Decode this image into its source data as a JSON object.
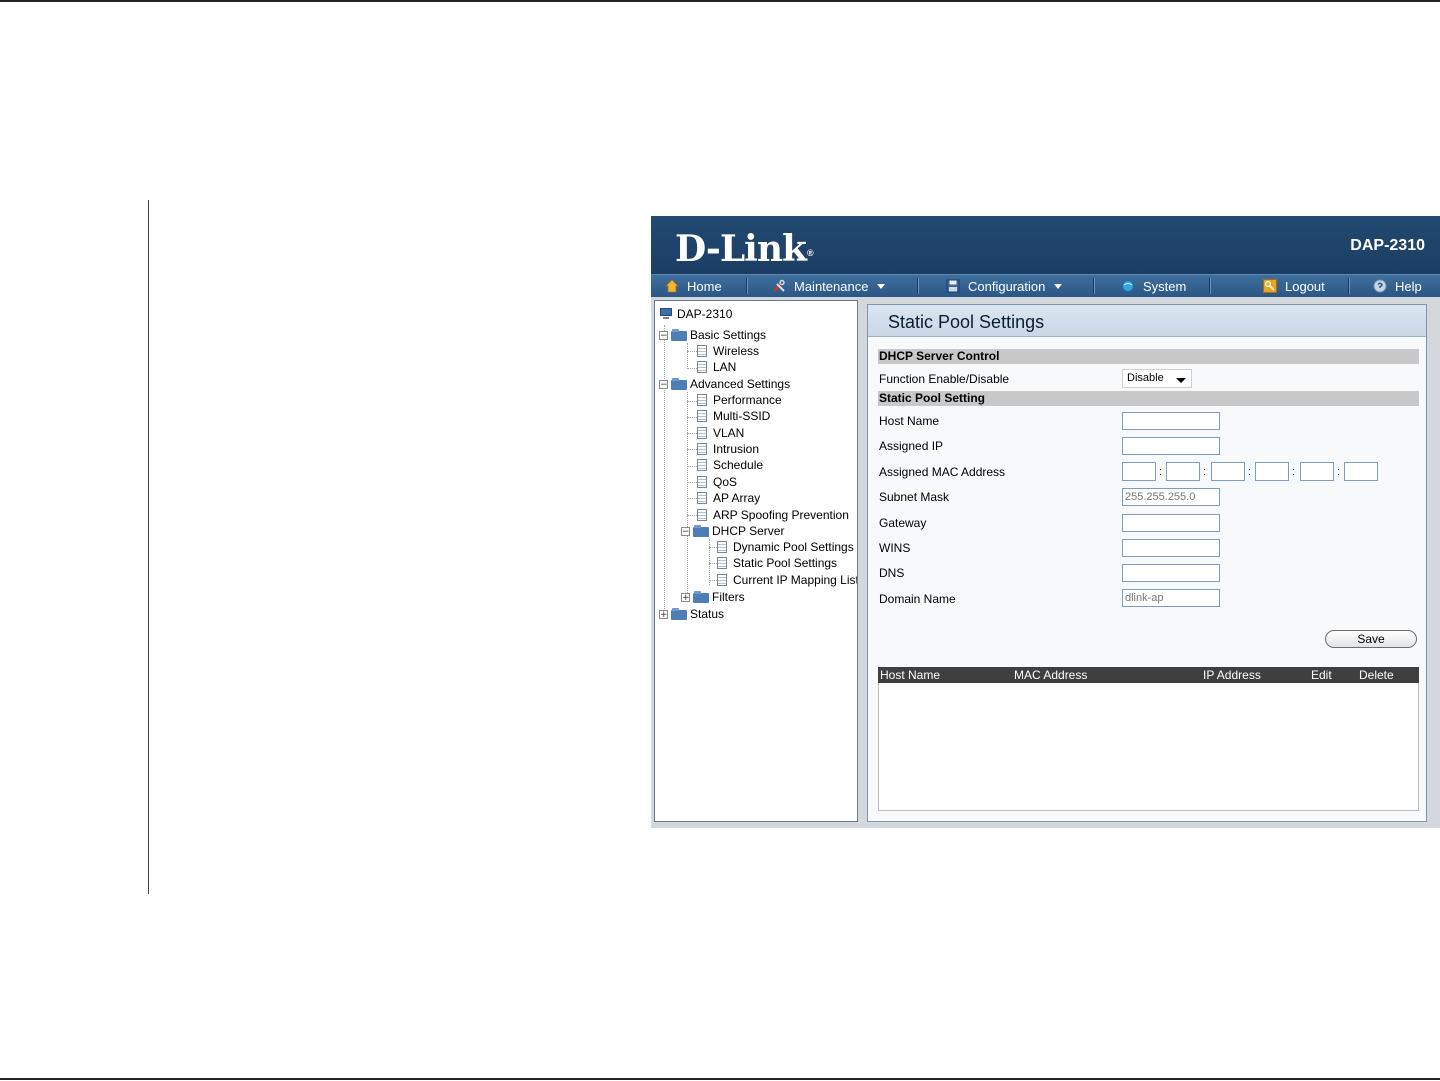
{
  "app": {
    "brand": "D-Link",
    "model": "DAP-2310"
  },
  "menu": {
    "home": "Home",
    "maintenance": "Maintenance",
    "configuration": "Configuration",
    "system": "System",
    "logout": "Logout",
    "help": "Help"
  },
  "tree": {
    "root": "DAP-2310",
    "basic_settings": "Basic Settings",
    "wireless": "Wireless",
    "lan": "LAN",
    "advanced_settings": "Advanced Settings",
    "performance": "Performance",
    "multi_ssid": "Multi-SSID",
    "vlan": "VLAN",
    "intrusion": "Intrusion",
    "schedule": "Schedule",
    "qos": "QoS",
    "ap_array": "AP Array",
    "arp_spoofing": "ARP Spoofing Prevention",
    "dhcp_server": "DHCP Server",
    "dynamic_pool": "Dynamic Pool Settings",
    "static_pool": "Static Pool Settings",
    "current_ip_mapping": "Current IP Mapping List",
    "filters": "Filters",
    "status": "Status"
  },
  "main": {
    "title": "Static Pool Settings",
    "dhcp_control_header": "DHCP Server Control",
    "function_label": "Function Enable/Disable",
    "function_value": "Disable",
    "static_pool_header": "Static Pool Setting",
    "host_name_label": "Host Name",
    "assigned_ip_label": "Assigned IP",
    "assigned_mac_label": "Assigned MAC Address",
    "subnet_mask_label": "Subnet Mask",
    "subnet_mask_value": "255.255.255.0",
    "gateway_label": "Gateway",
    "wins_label": "WINS",
    "dns_label": "DNS",
    "domain_name_label": "Domain Name",
    "domain_name_value": "dlink-ap",
    "save_label": "Save",
    "mac_separator": ":",
    "table_headers": {
      "host_name": "Host Name",
      "mac_address": "MAC Address",
      "ip_address": "IP Address",
      "edit": "Edit",
      "delete": "Delete"
    }
  }
}
